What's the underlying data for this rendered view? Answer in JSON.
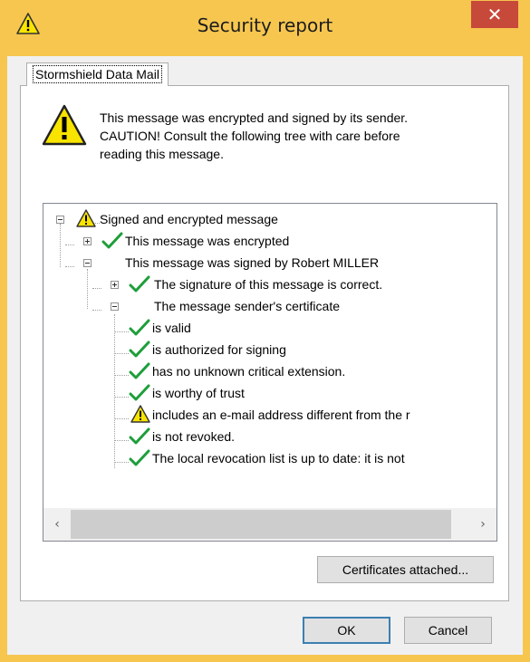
{
  "window": {
    "title": "Security report",
    "close_glyph": "✕",
    "title_icon": "warning-icon"
  },
  "tab": {
    "label": "Stormshield Data Mail"
  },
  "intro": {
    "icon": "warning-icon",
    "lines": [
      "This message was encrypted and signed by its sender.",
      "CAUTION! Consult the following tree with care before",
      "reading this message."
    ]
  },
  "tree": {
    "nodes": [
      {
        "label": "Signed and encrypted message",
        "icon": "warning-icon",
        "expander": "minus"
      },
      {
        "label": "This message was encrypted",
        "icon": "checkmark-icon",
        "expander": "plus"
      },
      {
        "label": "This message was signed by Robert MILLER",
        "icon": "none",
        "expander": "minus"
      },
      {
        "label": "The signature of this message is correct.",
        "icon": "checkmark-icon",
        "expander": "plus"
      },
      {
        "label": "The message sender's certificate",
        "icon": "none",
        "expander": "minus"
      },
      {
        "label": "is valid",
        "icon": "checkmark-icon"
      },
      {
        "label": "is authorized for signing",
        "icon": "checkmark-icon"
      },
      {
        "label": "has no unknown critical extension.",
        "icon": "checkmark-icon"
      },
      {
        "label": "is worthy of trust",
        "icon": "checkmark-icon"
      },
      {
        "label": "includes an e-mail address different from the r",
        "icon": "warning-icon"
      },
      {
        "label": "is not revoked.",
        "icon": "checkmark-icon"
      },
      {
        "label": "The local revocation list is up to date: it is not",
        "icon": "checkmark-icon"
      }
    ],
    "scroll_left": "‹",
    "scroll_right": "›"
  },
  "buttons": {
    "certificates": "Certificates attached...",
    "ok": "OK",
    "cancel": "Cancel"
  },
  "colors": {
    "frame": "#f6c64f",
    "close": "#c7493a",
    "check": "#1e9e3a",
    "warning_fill": "#f9e400"
  }
}
